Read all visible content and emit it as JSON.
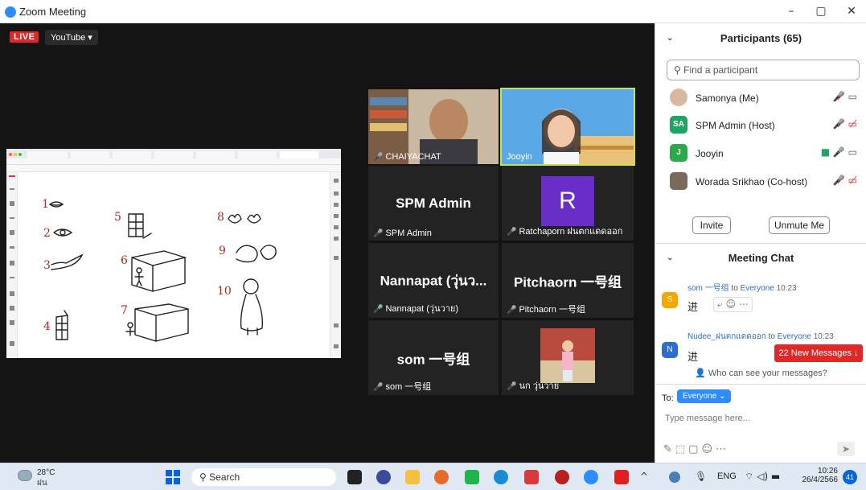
{
  "window": {
    "title": "Zoom Meeting",
    "minimize": "–",
    "restore": "▢",
    "close": "✕"
  },
  "stage": {
    "live_badge": "LIVE",
    "stream_target": "YouTube ▾"
  },
  "tiles": [
    {
      "name": "CHAIYACHAT",
      "type": "video"
    },
    {
      "name": "Jooyin",
      "type": "video"
    },
    {
      "name": "SPM Admin",
      "label": "SPM Admin",
      "type": "text"
    },
    {
      "name": "R",
      "label": "Ratchaporn ฝนตกแดดออก",
      "type": "avatar"
    },
    {
      "name": "Nannapat (วุ่นว...",
      "label": "Nannapat (วุ่นวาย)",
      "type": "text"
    },
    {
      "name": "Pitchaorn 一号组",
      "label": "Pitchaorn 一号组",
      "type": "text"
    },
    {
      "name": "som 一号组",
      "label": "som 一号组",
      "type": "text"
    },
    {
      "name": "นก วุ่นวาย",
      "label": "นก วุ่นวาย",
      "type": "photo"
    }
  ],
  "participants": {
    "header": "Participants (65)",
    "search_placeholder": "Find a participant",
    "list": [
      {
        "name": "Samonya (Me)",
        "initials": "",
        "color": "#d9b8a0"
      },
      {
        "name": "SPM Admin (Host)",
        "initials": "SA",
        "color": "#1fa463"
      },
      {
        "name": "Jooyin",
        "initials": "J",
        "color": "#2aa84a"
      },
      {
        "name": "Worada Srikhao (Co-host)",
        "initials": "",
        "color": "#7a6a5a"
      }
    ],
    "invite": "Invite",
    "unmute": "Unmute Me"
  },
  "chat": {
    "header": "Meeting Chat",
    "messages": [
      {
        "sender": "som 一号组",
        "to": "to",
        "recipient": "Everyone",
        "time": "10:23",
        "text": "进",
        "avatar": "S",
        "color": "#f7a600"
      },
      {
        "sender": "Nudee_ฝนตกแดดออก",
        "to": "to",
        "recipient": "Everyone",
        "time": "10:23",
        "text": "进",
        "avatar": "N",
        "color": "#2d6dd0"
      }
    ],
    "new_messages": "22 New Messages ↓",
    "who_can_see": "Who can see your messages?",
    "to_label": "To:",
    "recipient_button": "Everyone ⌄",
    "input_placeholder": "Type message here..."
  },
  "taskbar": {
    "temp": "28°C",
    "weather_desc": "ฝน",
    "search": "Search",
    "lang": "ENG",
    "time": "10:26",
    "date": "26/4/2566",
    "badge": "41"
  }
}
